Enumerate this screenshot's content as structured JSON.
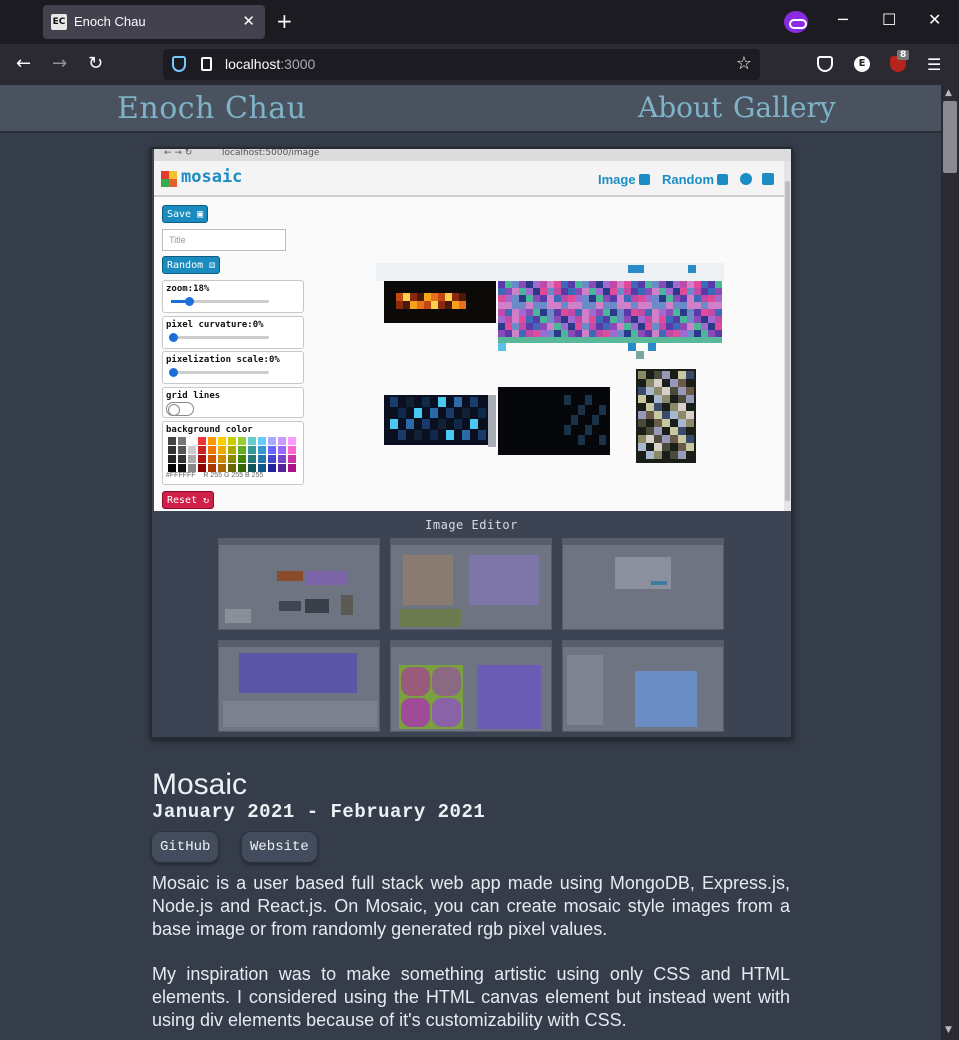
{
  "browser": {
    "tab_favicon": "EC",
    "tab_title": "Enoch Chau",
    "url_host": "localhost",
    "url_port": ":3000",
    "extension_badge": "8",
    "ext_e_label": "E"
  },
  "site": {
    "brand": "Enoch Chau",
    "nav": [
      "About",
      "Gallery"
    ]
  },
  "mosaic_app": {
    "url": "localhost:5000/image",
    "logo_text": "mosaic",
    "nav_image": "Image",
    "nav_random": "Random",
    "save_label": "Save",
    "title_placeholder": "Title",
    "random_label": "Random",
    "controls": [
      {
        "label": "zoom:18%",
        "value": 0.18
      },
      {
        "label": "pixel curvature:0%",
        "value": 0
      },
      {
        "label": "pixelization scale:0%",
        "value": 0
      }
    ],
    "grid_lines_label": "grid lines",
    "bg_color_label": "background color",
    "hex_value": "#FFFFFF",
    "rgb_label": "R 255   G 255   B 255",
    "reset_label": "Reset"
  },
  "gallery": {
    "caption": "Image Editor"
  },
  "project": {
    "title": "Mosaic",
    "dates": "January 2021 - February 2021",
    "links": [
      "GitHub",
      "Website"
    ],
    "paragraphs": [
      "Mosaic is a user based full stack web app made using MongoDB, Express.js, Node.js and React.js. On Mosaic, you can create mosaic style images from a base image or from randomly generated rgb pixel values.",
      "My inspiration was to make something artistic using only CSS and HTML elements. I considered using the HTML canvas element but instead went with using div elements because of it's customizability with CSS."
    ]
  },
  "colors": {
    "page_bg": "#363d4a",
    "header_bg": "#4a5260",
    "accent": "#7fb4c8",
    "mosaic_blue": "#1b8cc4",
    "reset_red": "#d02049"
  },
  "icons": {
    "back": "arrow-left-icon",
    "forward": "arrow-right-icon",
    "reload": "reload-icon",
    "bookmark": "star-icon",
    "menu": "hamburger-icon"
  }
}
